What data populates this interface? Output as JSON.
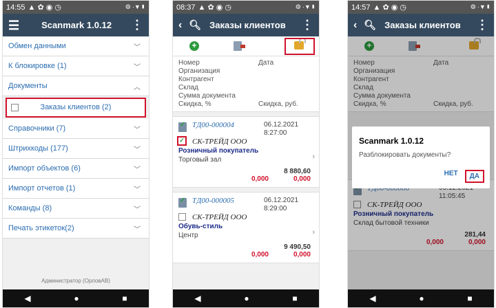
{
  "screen1": {
    "status_time": "14:55",
    "status_icons": "▲ ✿ ◉ ◷",
    "status_right": "⨷ ·▼▮",
    "title": "Scanmark 1.0.12",
    "menu": [
      {
        "label": "Обмен данными"
      },
      {
        "label": "К блокировке (1)"
      },
      {
        "label": "Документы"
      },
      {
        "label": "Справочники (7)"
      },
      {
        "label": "Штрихкоды (177)"
      },
      {
        "label": "Импорт объектов (6)"
      },
      {
        "label": "Импорт отчетов (1)"
      },
      {
        "label": "Команды (8)"
      },
      {
        "label": "Печать этикеток(2)"
      }
    ],
    "sub_item": "Заказы клиентов (2)",
    "footer": "Администратор (ОрловАВ)"
  },
  "screen2": {
    "status_time": "08:37",
    "status_icons": "▲ ✿ ◉ ◷",
    "status_right": "⨷ ·▼▮",
    "title": "Заказы клиентов",
    "header": {
      "left": [
        "Номер",
        "Организация",
        "Контрагент",
        "Склад",
        "Сумма документа",
        "Скидка, %"
      ],
      "right_top": "Дата",
      "right_bottom": "Скидка, руб."
    },
    "cards": [
      {
        "num": "ТД00-000004",
        "date": "06.12.2021",
        "time": "8:27:00",
        "org": "СК-ТРЕЙД ООО",
        "contractor": "Розничный покупатель",
        "warehouse": "Торговый зал",
        "sum": "8 880,60",
        "disc_pct": "0,000",
        "disc_rub": "0,000"
      },
      {
        "num": "ТД00-000005",
        "date": "06.12.2021",
        "time": "8:29:00",
        "org": "СК-ТРЕЙД ООО",
        "contractor": "Обувь-стиль",
        "warehouse": "Центр",
        "sum": "9 490,50",
        "disc_pct": "0,000",
        "disc_rub": "0,000"
      }
    ]
  },
  "screen3": {
    "status_time": "14:57",
    "status_icons": "▲ ✿ ◉ ◷",
    "status_right": "⨷ ·▼▮",
    "title": "Заказы клиентов",
    "header": {
      "left": [
        "Номер",
        "Организация",
        "Контрагент",
        "Склад",
        "Сумма документа",
        "Скидка, %"
      ],
      "right_top": "Дата",
      "right_bottom": "Скидка, руб."
    },
    "dialog": {
      "title": "Scanmark 1.0.12",
      "message": "Разблокировать документы?",
      "no": "НЕТ",
      "yes": "ДА"
    },
    "card": {
      "num": "ТД00-000006",
      "date": "06.12.2021",
      "time": "11:05:45",
      "org": "СК-ТРЕЙД ООО",
      "contractor": "Розничный покупатель",
      "warehouse": "Склад бытовой техники",
      "sum": "281,44",
      "disc_pct": "0,000",
      "disc_rub": "0,000"
    }
  },
  "nav": {
    "back": "◀",
    "home": "●",
    "recents": "■"
  }
}
